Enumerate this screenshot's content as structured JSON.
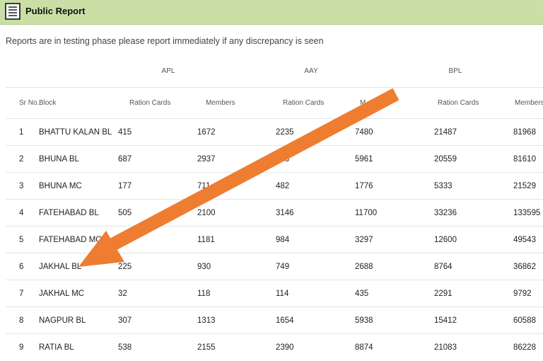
{
  "header": {
    "title": "Public Report",
    "icon": "document-list-icon"
  },
  "notice": "Reports are in testing phase please report immediately if any discrepancy is seen",
  "table": {
    "groups": [
      "APL",
      "AAY",
      "BPL"
    ],
    "columns": [
      "Sr No.",
      "Block",
      "Ration Cards",
      "Members",
      "Ration Cards",
      "M",
      "Ration Cards",
      "Members"
    ],
    "rows": [
      [
        "1",
        "BHATTU KALAN BL",
        "415",
        "1672",
        "2235",
        "7480",
        "21487",
        "81968"
      ],
      [
        "2",
        "BHUNA BL",
        "687",
        "2937",
        "383",
        "5961",
        "20559",
        "81610"
      ],
      [
        "3",
        "BHUNA MC",
        "177",
        "711",
        "482",
        "1776",
        "5333",
        "21529"
      ],
      [
        "4",
        "FATEHABAD BL",
        "505",
        "2100",
        "3146",
        "11700",
        "33236",
        "133595"
      ],
      [
        "5",
        "FATEHABAD MC",
        "",
        "1181",
        "984",
        "3297",
        "12600",
        "49543"
      ],
      [
        "6",
        "JAKHAL BL",
        "225",
        "930",
        "749",
        "2688",
        "8764",
        "36862"
      ],
      [
        "7",
        "JAKHAL MC",
        "32",
        "118",
        "114",
        "435",
        "2291",
        "9792"
      ],
      [
        "8",
        "NAGPUR BL",
        "307",
        "1313",
        "1654",
        "5938",
        "15412",
        "60588"
      ],
      [
        "9",
        "RATIA BL",
        "538",
        "2155",
        "2390",
        "8874",
        "21083",
        "86228"
      ]
    ]
  },
  "annotation": {
    "arrow_color": "#ee7d31"
  }
}
